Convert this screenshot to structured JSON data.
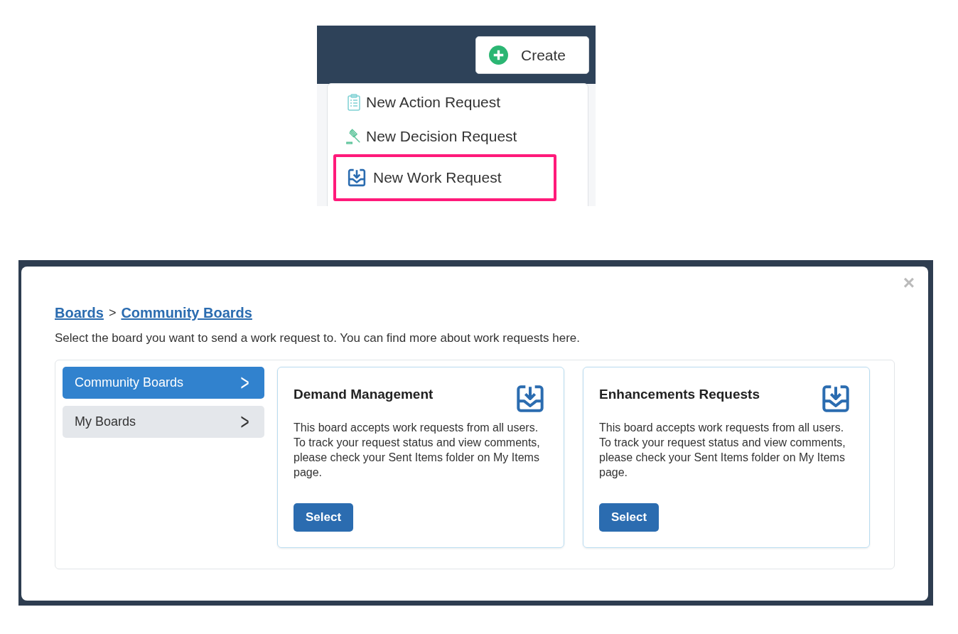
{
  "create_menu": {
    "button": "Create",
    "items": [
      {
        "label": "New Action Request",
        "kind": "action",
        "highlighted": false
      },
      {
        "label": "New Decision Request",
        "kind": "decision",
        "highlighted": false
      },
      {
        "label": "New Work Request",
        "kind": "work",
        "highlighted": true
      }
    ]
  },
  "dialog": {
    "close": "×",
    "breadcrumb": [
      "Boards",
      "Community Boards"
    ],
    "separator": ">",
    "description": "Select the board you want to send a work request to. You can find more about work requests here.",
    "sidebar": [
      {
        "label": "Community Boards",
        "chevron": ">",
        "selected": true
      },
      {
        "label": "My Boards",
        "chevron": ">",
        "selected": false
      }
    ],
    "boards": [
      {
        "title": "Demand Management",
        "text": "This board accepts work requests from all users. To track your request status and view comments, please check your Sent Items folder on My Items page.",
        "button": "Select"
      },
      {
        "title": "Enhancements Requests",
        "text": "This board accepts work requests from all users. To track your request status and view comments, please check your Sent Items folder on My Items page.",
        "button": "Select"
      }
    ]
  }
}
